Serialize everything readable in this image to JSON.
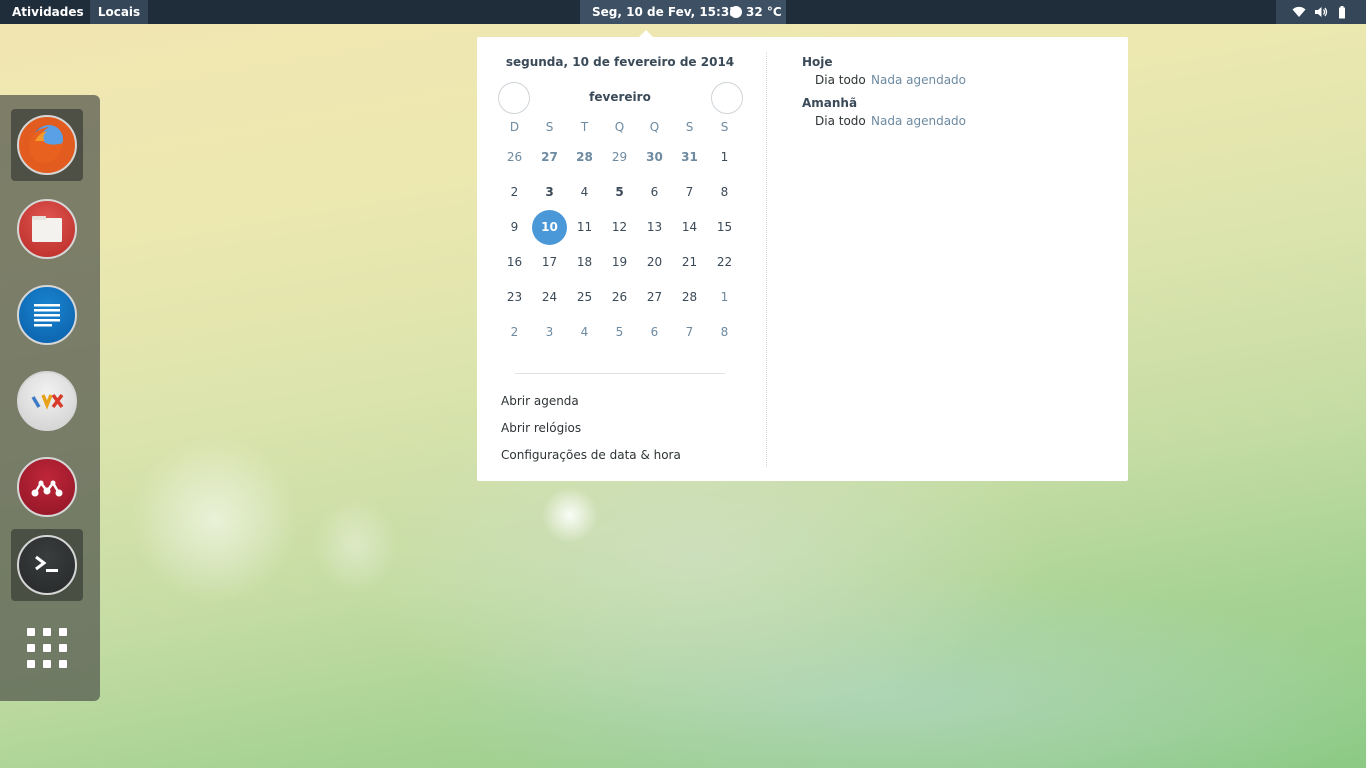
{
  "topbar": {
    "activities": "Atividades",
    "places": "Locais",
    "clock": "Seg, 10 de Fev, 15:35",
    "temperature": "32 °C",
    "status_icons": [
      "wifi-icon",
      "volume-icon",
      "battery-icon"
    ]
  },
  "dock": {
    "apps": [
      {
        "name": "firefox",
        "icon": "firefox-icon",
        "active": true
      },
      {
        "name": "files",
        "icon": "files-icon",
        "active": false
      },
      {
        "name": "text-editor",
        "icon": "text-editor-icon",
        "active": false
      },
      {
        "name": "lyx",
        "icon": "lyx-icon",
        "active": false
      },
      {
        "name": "mendeley",
        "icon": "mendeley-icon",
        "active": false
      },
      {
        "name": "terminal",
        "icon": "terminal-icon",
        "active": true
      }
    ],
    "show_apps": "app-grid-icon"
  },
  "calendar": {
    "full_date": "segunda, 10 de fevereiro de 2014",
    "month": "fevereiro",
    "weekdays": [
      "D",
      "S",
      "T",
      "Q",
      "Q",
      "S",
      "S"
    ],
    "weeks": [
      [
        {
          "d": "26",
          "t": "other"
        },
        {
          "d": "27",
          "t": "other-bold"
        },
        {
          "d": "28",
          "t": "other-bold"
        },
        {
          "d": "29",
          "t": "other"
        },
        {
          "d": "30",
          "t": "other-bold"
        },
        {
          "d": "31",
          "t": "other-bold"
        },
        {
          "d": "1",
          "t": "normal"
        }
      ],
      [
        {
          "d": "2",
          "t": "normal"
        },
        {
          "d": "3",
          "t": "bold"
        },
        {
          "d": "4",
          "t": "normal"
        },
        {
          "d": "5",
          "t": "bold"
        },
        {
          "d": "6",
          "t": "normal"
        },
        {
          "d": "7",
          "t": "normal"
        },
        {
          "d": "8",
          "t": "normal"
        }
      ],
      [
        {
          "d": "9",
          "t": "normal"
        },
        {
          "d": "10",
          "t": "today"
        },
        {
          "d": "11",
          "t": "normal"
        },
        {
          "d": "12",
          "t": "normal"
        },
        {
          "d": "13",
          "t": "normal"
        },
        {
          "d": "14",
          "t": "normal"
        },
        {
          "d": "15",
          "t": "normal"
        }
      ],
      [
        {
          "d": "16",
          "t": "normal"
        },
        {
          "d": "17",
          "t": "normal"
        },
        {
          "d": "18",
          "t": "normal"
        },
        {
          "d": "19",
          "t": "normal"
        },
        {
          "d": "20",
          "t": "normal"
        },
        {
          "d": "21",
          "t": "normal"
        },
        {
          "d": "22",
          "t": "normal"
        }
      ],
      [
        {
          "d": "23",
          "t": "normal"
        },
        {
          "d": "24",
          "t": "normal"
        },
        {
          "d": "25",
          "t": "normal"
        },
        {
          "d": "26",
          "t": "normal"
        },
        {
          "d": "27",
          "t": "normal"
        },
        {
          "d": "28",
          "t": "normal"
        },
        {
          "d": "1",
          "t": "other"
        }
      ],
      [
        {
          "d": "2",
          "t": "other"
        },
        {
          "d": "3",
          "t": "other"
        },
        {
          "d": "4",
          "t": "other"
        },
        {
          "d": "5",
          "t": "other"
        },
        {
          "d": "6",
          "t": "other"
        },
        {
          "d": "7",
          "t": "other"
        },
        {
          "d": "8",
          "t": "other"
        }
      ]
    ],
    "links": [
      "Abrir agenda",
      "Abrir relógios",
      "Configurações de data & hora"
    ],
    "accent_color": "#4a98d8"
  },
  "events": {
    "today": {
      "heading": "Hoje",
      "time": "Dia todo",
      "desc": "Nada agendado"
    },
    "tomorrow": {
      "heading": "Amanhã",
      "time": "Dia todo",
      "desc": "Nada agendado"
    }
  }
}
